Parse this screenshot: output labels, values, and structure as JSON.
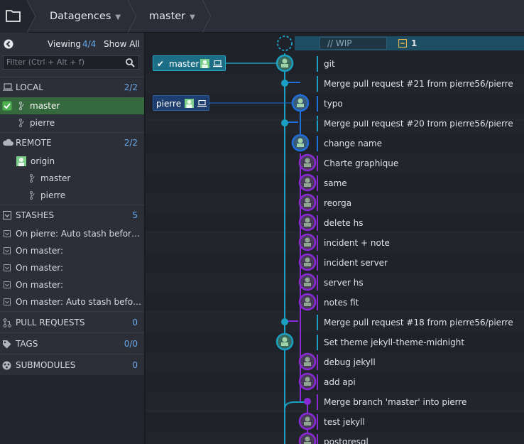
{
  "toolbar": {
    "repo": "Datagences",
    "branch": "master"
  },
  "sidebar": {
    "viewing_label": "Viewing",
    "viewing_count": "4/4",
    "show_all": "Show All",
    "filter_placeholder": "Filter (Ctrl + Alt + f)",
    "local": {
      "label": "LOCAL",
      "count": "2/2",
      "branches": [
        "master",
        "pierre"
      ]
    },
    "remote": {
      "label": "REMOTE",
      "count": "2/2",
      "origin": "origin",
      "branches": [
        "master",
        "pierre"
      ]
    },
    "stashes": {
      "label": "STASHES",
      "count": "5",
      "items": [
        "On pierre: Auto stash befor…",
        "On master:",
        "On master:",
        "On master:",
        "On master: Auto stash befo…"
      ]
    },
    "pull_requests": {
      "label": "PULL REQUESTS",
      "count": "0"
    },
    "tags": {
      "label": "TAGS",
      "count": "0/0"
    },
    "submodules": {
      "label": "SUBMODULES",
      "count": "0"
    }
  },
  "graph": {
    "wip": {
      "placeholder": "// WIP",
      "count": "1"
    },
    "ref_tags": {
      "master": "master",
      "pierre": "pierre"
    },
    "commits": [
      "git",
      "Merge pull request #21 from pierre56/pierre",
      "typo",
      "Merge pull request #20 from pierre56/pierre",
      "change name",
      "Charte graphique",
      "same",
      "reorga",
      "delete hs",
      "incident + note",
      "incident server",
      "server hs",
      "notes fit",
      "Merge pull request #18 from pierre56/pierre",
      "Set theme jekyll-theme-midnight",
      "debug jekyll",
      "add api",
      "Merge branch 'master' into pierre",
      "test jekyll",
      "postgresql"
    ]
  },
  "colors": {
    "teal": "#1b9fc2",
    "blue": "#1e6fd9",
    "purple": "#8a2ad6",
    "selected": "#35683d"
  }
}
